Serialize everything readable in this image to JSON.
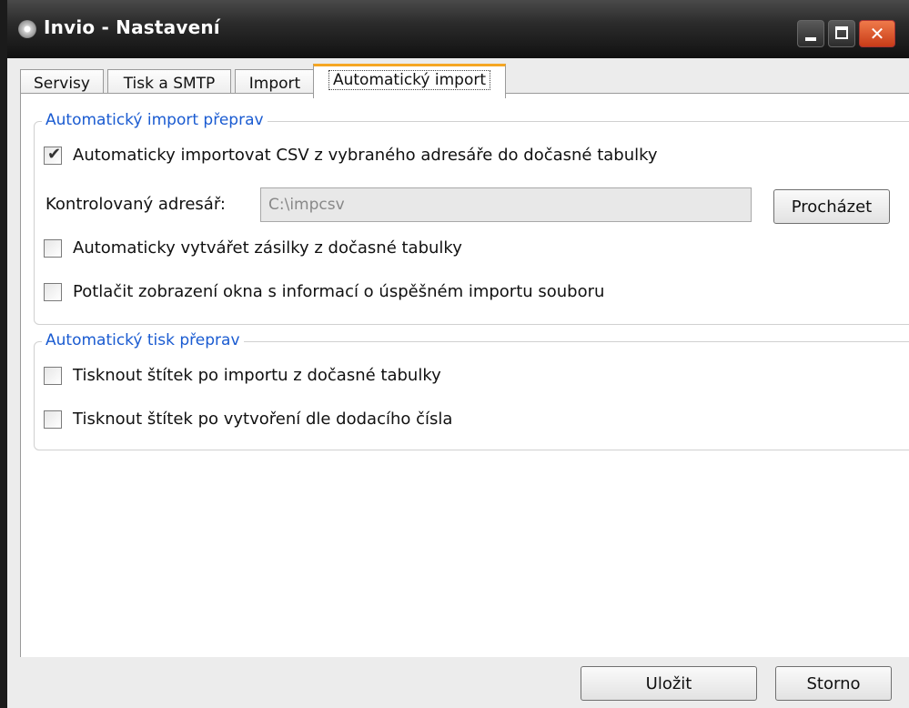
{
  "window": {
    "title": "Invio - Nastavení"
  },
  "tabs": [
    {
      "label": "Servisy"
    },
    {
      "label": "Tisk a SMTP"
    },
    {
      "label": "Import"
    },
    {
      "label": "Automatický import"
    }
  ],
  "active_tab": "Automatický import",
  "auto_import_group": {
    "title": "Automatický import přeprav",
    "auto_import_csv": {
      "label": "Automaticky importovat CSV z vybraného adresáře do dočasné tabulky",
      "checked": true
    },
    "directory": {
      "label": "Kontrolovaný adresář:",
      "value": "C:\\impcsv"
    },
    "browse_button": "Procházet",
    "auto_create": {
      "label": "Automaticky vytvářet zásilky z dočasné tabulky",
      "checked": false
    },
    "suppress_window": {
      "label": "Potlačit zobrazení okna s informací o úspěšném importu souboru",
      "checked": false
    }
  },
  "auto_print_group": {
    "title": "Automatický tisk přeprav",
    "print_after_import": {
      "label": "Tisknout štítek po importu z dočasné tabulky",
      "checked": false
    },
    "print_after_create": {
      "label": "Tisknout štítek po vytvoření dle dodacího čísla",
      "checked": false
    }
  },
  "footer": {
    "save_label": "Uložit",
    "cancel_label": "Storno"
  }
}
